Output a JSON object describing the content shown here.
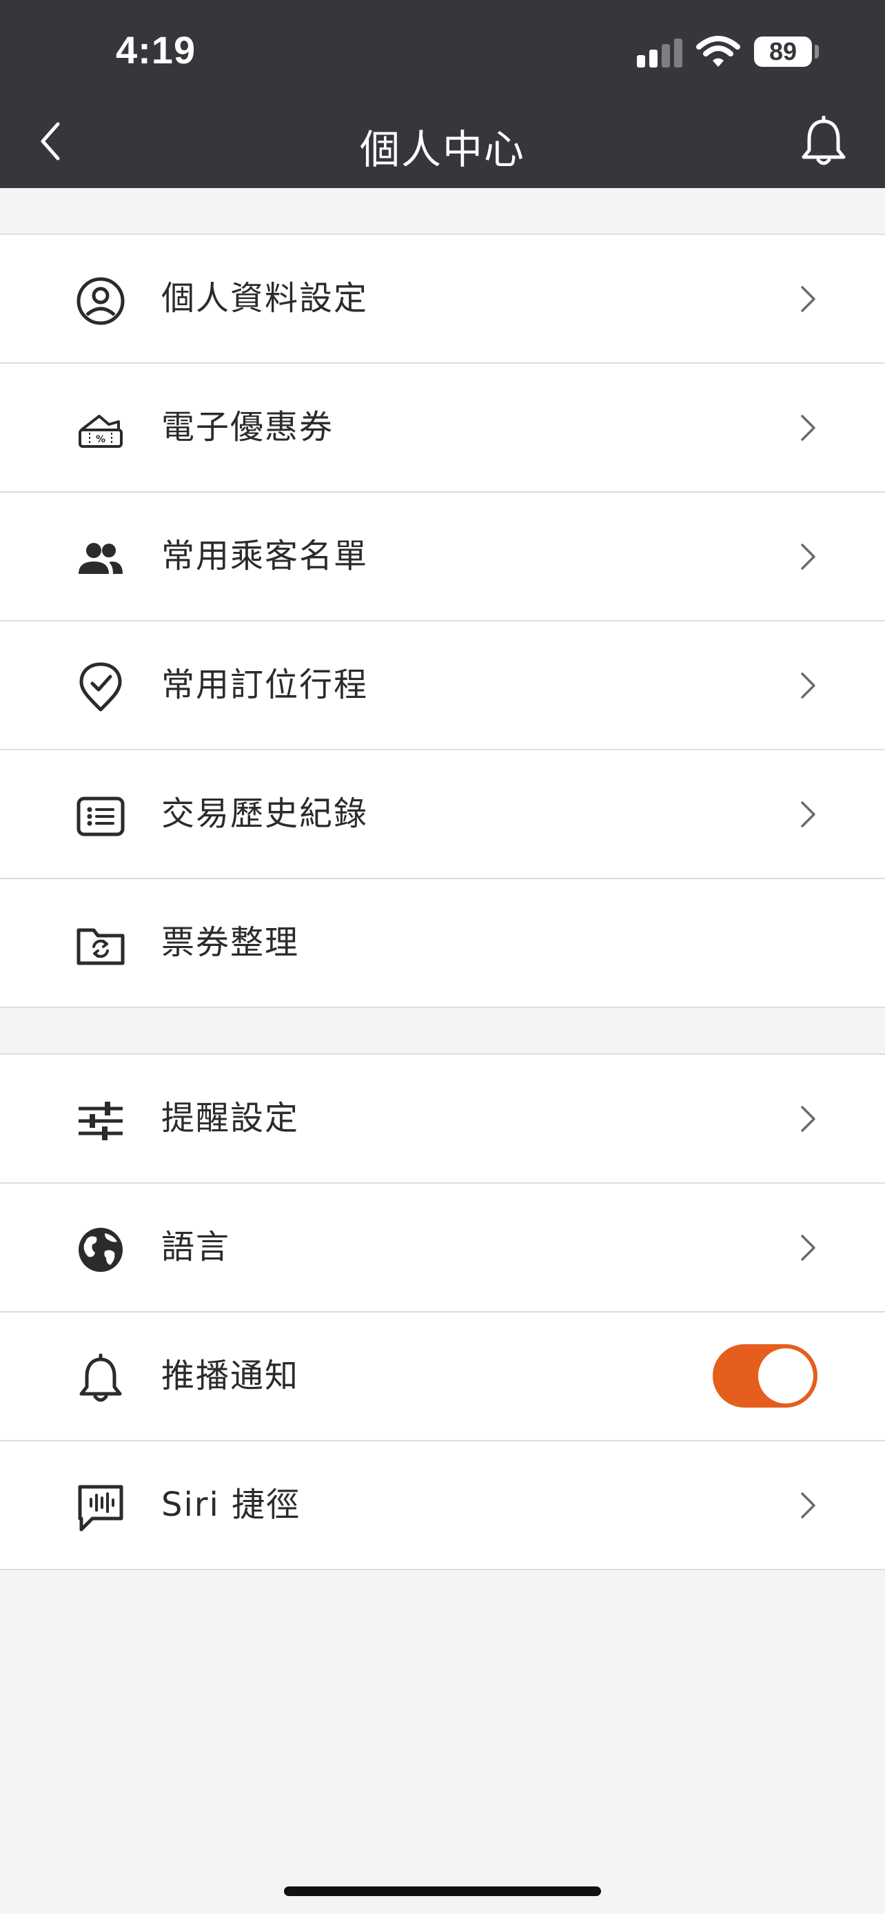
{
  "status_bar": {
    "time": "4:19",
    "battery": "89"
  },
  "header": {
    "title": "個人中心",
    "back_icon": "chevron-left-icon",
    "notification_icon": "bell-icon"
  },
  "section1": {
    "items": [
      {
        "label": "個人資料設定",
        "icon": "user-circle-icon"
      },
      {
        "label": "電子優惠券",
        "icon": "coupon-icon"
      },
      {
        "label": "常用乘客名單",
        "icon": "users-icon"
      },
      {
        "label": "常用訂位行程",
        "icon": "location-check-icon"
      },
      {
        "label": "交易歷史紀錄",
        "icon": "list-icon"
      },
      {
        "label": "票券整理",
        "icon": "folder-sync-icon"
      }
    ]
  },
  "section2": {
    "items": [
      {
        "label": "提醒設定",
        "icon": "sliders-icon"
      },
      {
        "label": "語言",
        "icon": "globe-icon"
      },
      {
        "label": "推播通知",
        "icon": "bell-icon",
        "toggle": true
      },
      {
        "label": "Siri 捷徑",
        "icon": "voice-message-icon"
      }
    ]
  },
  "colors": {
    "header_bg": "#35373c",
    "accent": "#e55e1d",
    "page_bg": "#f3f4f6"
  }
}
